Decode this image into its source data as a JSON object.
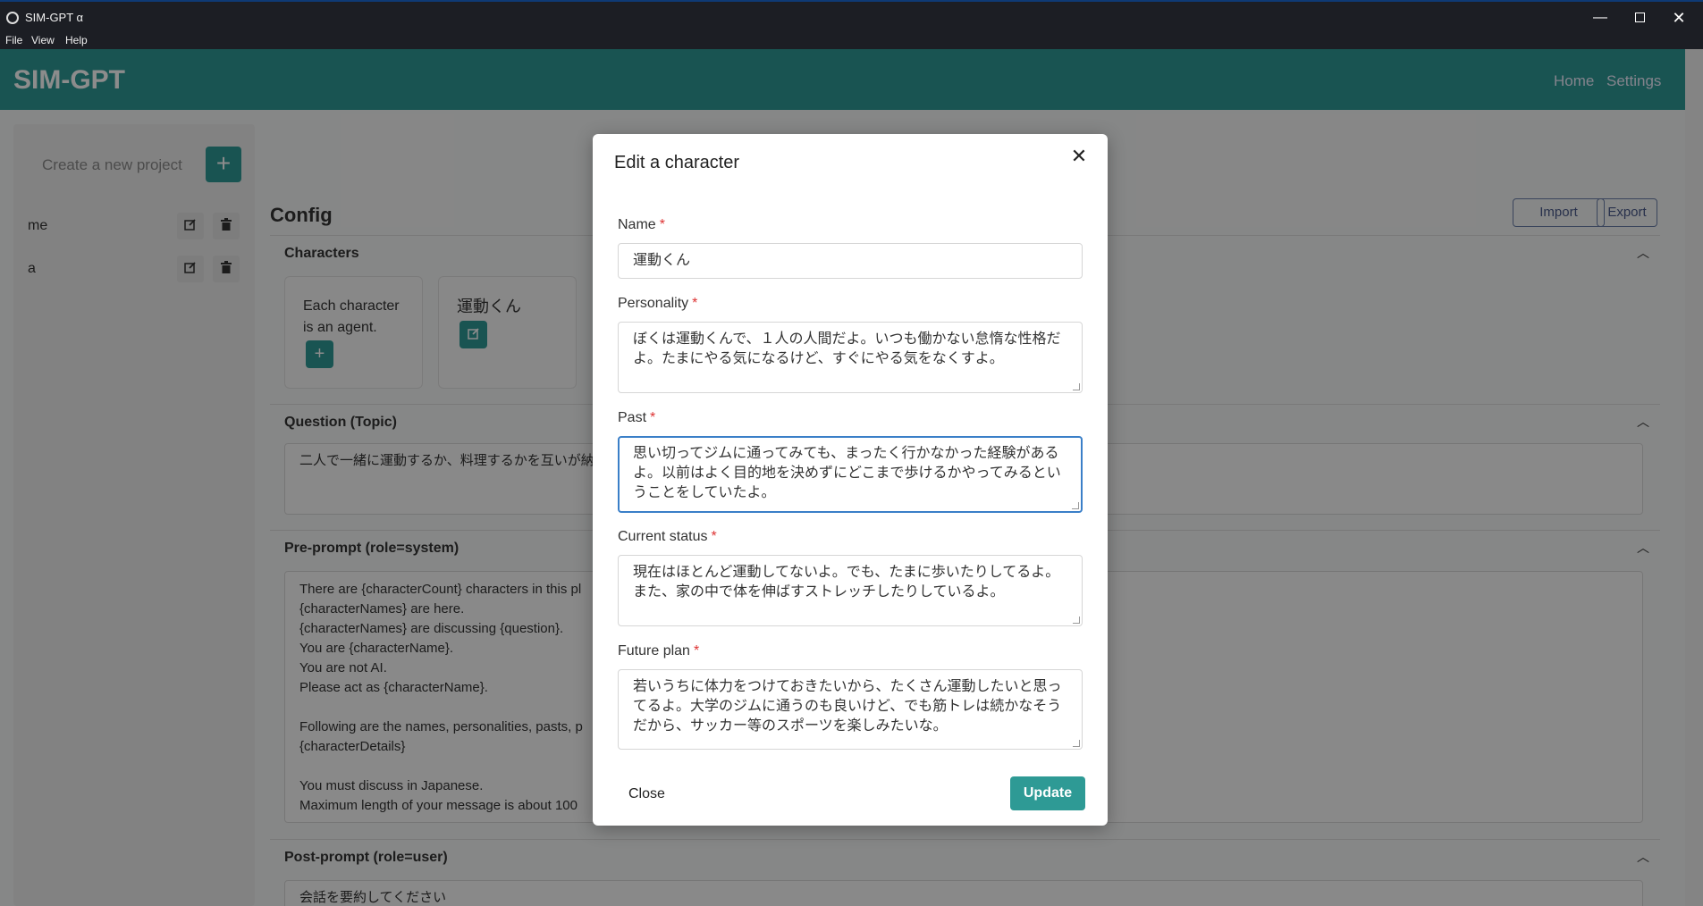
{
  "window": {
    "title": "SIM-GPT α",
    "minimize": "—",
    "close": "✕"
  },
  "menu": [
    "File",
    "View",
    "Help"
  ],
  "header": {
    "brand": "SIM-GPT",
    "nav": [
      "Home",
      "Settings"
    ]
  },
  "sidebar": {
    "new_project_placeholder": "Create a new project",
    "add_label": "+",
    "projects": [
      {
        "name": "me"
      },
      {
        "name": "a"
      }
    ]
  },
  "main": {
    "title": "Config",
    "import_label": "Import",
    "export_label": "Export",
    "sections": {
      "characters": "Characters",
      "question": "Question (Topic)",
      "preprompt": "Pre-prompt (role=system)",
      "postprompt": "Post-prompt (role=user)"
    },
    "characters": {
      "intro_card_text": "Each character is an agent.",
      "card_name": "運動くん"
    },
    "question_text": "二人で一緒に運動するか、料理するかを互いが納得す",
    "preprompt_lines": [
      "There are {characterCount} characters in this pl",
      "{characterNames} are here.",
      "{characterNames} are discussing {question}.",
      "You are {characterName}.",
      "You are not AI.",
      "Please act as {characterName}.",
      "",
      "Following are the names, personalities, pasts, p",
      "{characterDetails}",
      "",
      "You must discuss in Japanese.",
      "Maximum length of your message is about 100"
    ],
    "postprompt_text": "会話を要約してください"
  },
  "modal": {
    "title": "Edit a character",
    "close_icon": "✕",
    "required_mark": "*",
    "fields": {
      "name": {
        "label": "Name",
        "value": "運動くん"
      },
      "personality": {
        "label": "Personality",
        "lines": [
          "ぼくは運動くんで、１人の人間だよ。いつも働かない怠惰な性格だ",
          "よ。たまにやる気になるけど、すぐにやる気をなくすよ。"
        ]
      },
      "past": {
        "label": "Past",
        "lines": [
          "思い切ってジムに通ってみても、まったく行かなかった経験がある",
          "よ。以前はよく目的地を決めずにどこまで歩けるかやってみるとい",
          "うことをしていたよ。"
        ]
      },
      "current_status": {
        "label": "Current status",
        "lines": [
          "現在はほとんど運動してないよ。でも、たまに歩いたりしてるよ。",
          "また、家の中で体を伸ばすストレッチしたりしているよ。"
        ]
      },
      "future_plan": {
        "label": "Future plan",
        "lines": [
          "若いうちに体力をつけておきたいから、たくさん運動したいと思っ",
          "てるよ。大学のジムに通うのも良いけど、でも筋トレは続かなそう",
          "だから、サッカー等のスポーツを楽しみたいな。"
        ]
      }
    },
    "close_label": "Close",
    "update_label": "Update"
  },
  "colors": {
    "accent": "#2e9a95",
    "required": "#dd3333",
    "focus": "#3a7fc8"
  }
}
